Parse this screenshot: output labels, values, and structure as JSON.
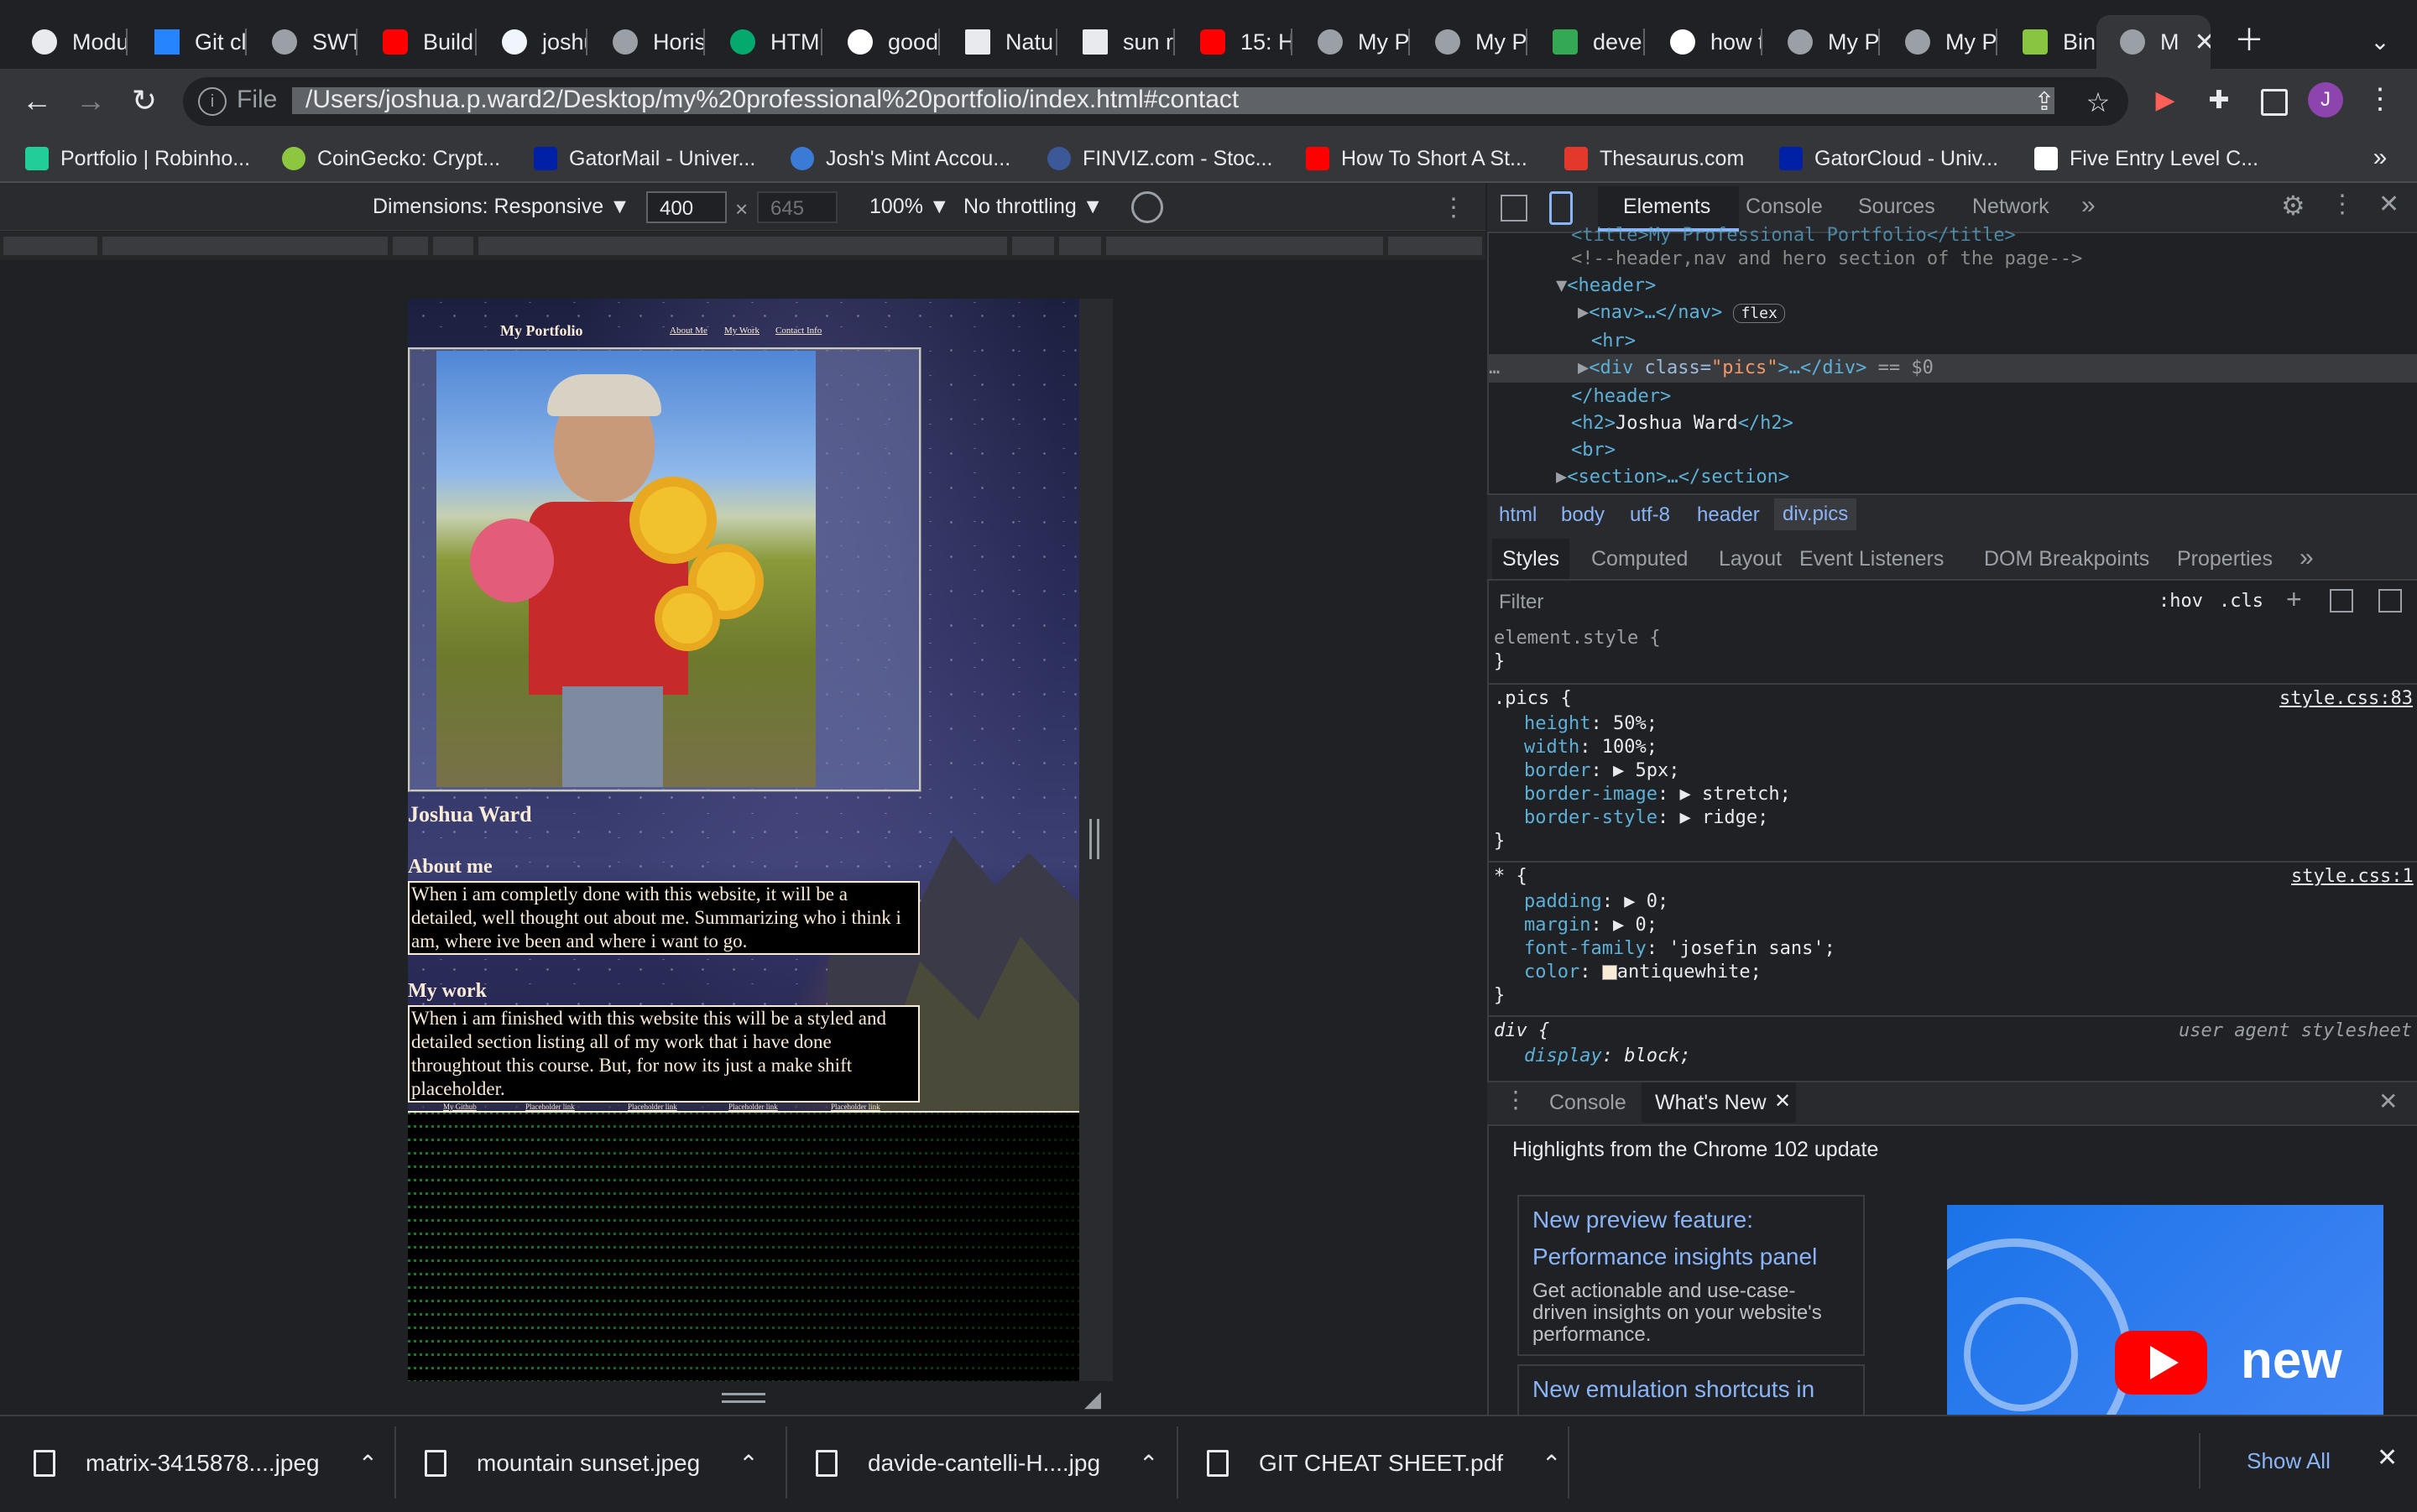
{
  "tabs": [
    {
      "label": "Modu"
    },
    {
      "label": "Git cl"
    },
    {
      "label": "SWT"
    },
    {
      "label": "Build"
    },
    {
      "label": "joshu"
    },
    {
      "label": "Horis"
    },
    {
      "label": "HTM"
    },
    {
      "label": "good"
    },
    {
      "label": "Natu"
    },
    {
      "label": "sun r"
    },
    {
      "label": "15: H"
    },
    {
      "label": "My P"
    },
    {
      "label": "My P"
    },
    {
      "label": "devel"
    },
    {
      "label": "how t"
    },
    {
      "label": "My P"
    },
    {
      "label": "My P"
    },
    {
      "label": "Binar"
    },
    {
      "label": "M"
    }
  ],
  "address": {
    "scheme_label": "File",
    "url": "/Users/joshua.p.ward2/Desktop/my%20professional%20portfolio/index.html#contact"
  },
  "profile_initial": "J",
  "bookmarks": [
    {
      "label": "Portfolio | Robinho...",
      "color": "#21ce99"
    },
    {
      "label": "CoinGecko: Crypt...",
      "color": "#8dc63f"
    },
    {
      "label": "GatorMail - Univer...",
      "color": "#0021a5"
    },
    {
      "label": "Josh's Mint Accou...",
      "color": "#3a7bd5"
    },
    {
      "label": "FINVIZ.com - Stoc...",
      "color": "#3b5998"
    },
    {
      "label": "How To Short A St...",
      "color": "#ff0000"
    },
    {
      "label": "Thesaurus.com",
      "color": "#e4382c"
    },
    {
      "label": "GatorCloud - Univ...",
      "color": "#0021a5"
    },
    {
      "label": "Five Entry Level C...",
      "color": "#ffffff"
    }
  ],
  "device_toolbar": {
    "dimensions_label": "Dimensions: Responsive",
    "width": "400",
    "height": "645",
    "zoom": "100%",
    "throttling": "No throttling"
  },
  "site": {
    "brand": "My Portfolio",
    "nav": [
      "About Me",
      "My Work",
      "Contact Info"
    ],
    "name_heading": "Joshua Ward",
    "about_heading": "About me",
    "about_text": "When i am completly done with this website, it will be a detailed, well thought out about me. Summarizing who i think i am, where ive been and where i want to go.",
    "work_heading": "My work",
    "work_text": "When i am finished with this website this will be a styled and detailed section listing all of my work that i have done throughtout this course. But, for now its just a make shift placeholder.",
    "work_links": [
      "My Github",
      "Placeholder link",
      "Placeholder link",
      "Placeholder link",
      "Placeholder link"
    ]
  },
  "devtools": {
    "tabs": [
      "Elements",
      "Console",
      "Sources",
      "Network"
    ],
    "dom": {
      "title_line": "<title>My Professional Portfolio</title>",
      "comment": "<!--header,nav and hero section of the page-->",
      "header_open": "<header>",
      "nav": "<nav>…</nav>",
      "nav_badge": "flex",
      "hr": "<hr>",
      "div_open": "<div",
      "div_attr": "class=",
      "div_val": "\"pics\"",
      "div_rest": ">…</div>",
      "div_suffix": "== $0",
      "header_close": "</header>",
      "h2": "<h2>",
      "h2_text": "Joshua Ward",
      "h2_close": "</h2>",
      "br": "<br>",
      "section": "<section>…</section>"
    },
    "breadcrumbs": [
      "html",
      "body",
      "utf-8",
      "header",
      "div.pics"
    ],
    "style_tabs": [
      "Styles",
      "Computed",
      "Layout",
      "Event Listeners",
      "DOM Breakpoints",
      "Properties"
    ],
    "filter_placeholder": "Filter",
    "hov": ":hov",
    "cls": ".cls",
    "rules": {
      "element_style": "element.style {",
      "close": "}",
      "pics_selector": ".pics {",
      "pics_source": "style.css:83",
      "pics_props": [
        {
          "name": "height",
          "value": "50%;"
        },
        {
          "name": "width",
          "value": "100%;"
        },
        {
          "name": "border",
          "value": "▶ 5px;"
        },
        {
          "name": "border-image",
          "value": "▶ stretch;"
        },
        {
          "name": "border-style",
          "value": "▶ ridge;"
        }
      ],
      "star_selector": "* {",
      "star_source": "style.css:1",
      "star_props": [
        {
          "name": "padding",
          "value": "▶ 0;"
        },
        {
          "name": "margin",
          "value": "▶ 0;"
        },
        {
          "name": "font-family",
          "value": "'josefin sans';"
        },
        {
          "name": "color",
          "value": "antiquewhite;"
        }
      ],
      "div_selector": "div {",
      "div_source": "user agent stylesheet",
      "div_prop_name": "display",
      "div_prop_value": "block;"
    },
    "drawer_tabs": [
      "Console",
      "What's New"
    ],
    "whats_new_title": "Highlights from the Chrome 102 update",
    "card1_line1": "New preview feature:",
    "card1_line2": "Performance insights panel",
    "card1_desc": "Get actionable and use-case-driven insights on your website's performance.",
    "card2_title": "New emulation shortcuts in",
    "video_text": "new"
  },
  "downloads": [
    {
      "label": "matrix-3415878....jpeg"
    },
    {
      "label": "mountain sunset.jpeg"
    },
    {
      "label": "davide-cantelli-H....jpg"
    },
    {
      "label": "GIT CHEAT SHEET.pdf"
    }
  ],
  "show_all": "Show All",
  "colors": {
    "accent": "#8ab4f8",
    "antiquewhite": "#faebd7",
    "matrix_green": "#39ff6a"
  }
}
